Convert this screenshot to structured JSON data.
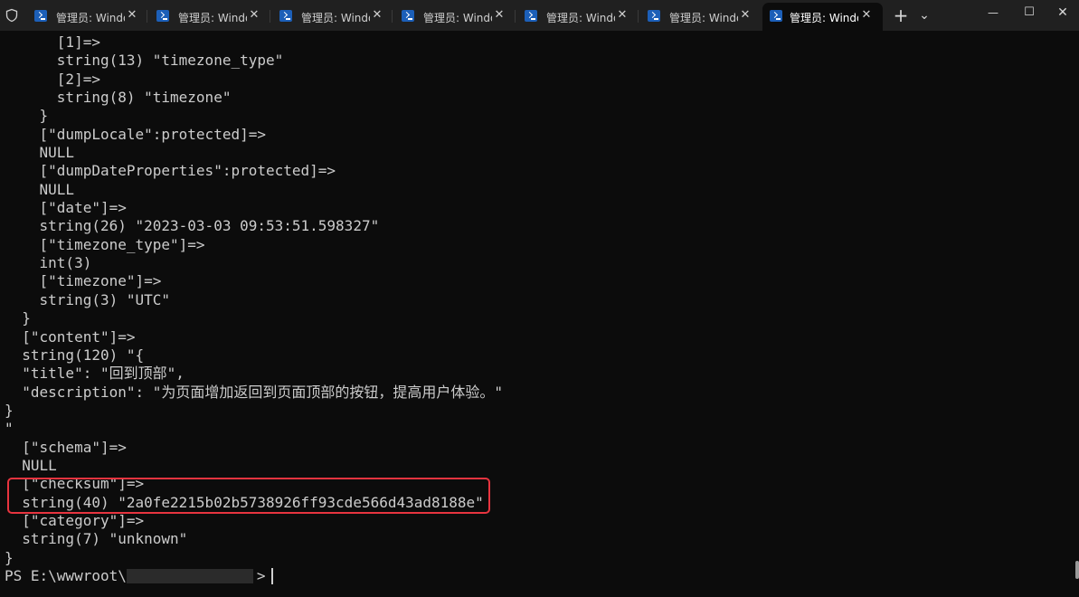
{
  "window": {
    "tabs": [
      {
        "label": "管理员: Windows PowerShell",
        "active": false
      },
      {
        "label": "管理员: Windows PowerShell",
        "active": false
      },
      {
        "label": "管理员: Windows PowerShell",
        "active": false
      },
      {
        "label": "管理员: Windows PowerShell",
        "active": false
      },
      {
        "label": "管理员: Windows PowerShell",
        "active": false
      },
      {
        "label": "管理员: Windows PowerShell",
        "active": false
      },
      {
        "label": "管理员: Windows PowerShell",
        "active": true
      }
    ],
    "tab_close_glyph": "✕",
    "new_tab_glyph": "+",
    "dropdown_glyph": "⌄",
    "controls": {
      "minimize": "—",
      "maximize": "☐",
      "close": "✕"
    },
    "icons": {
      "shield": "shield-icon",
      "tab": "powershell-icon"
    },
    "colors": {
      "titlebar": "#202020",
      "terminal_bg": "#0c0c0c",
      "text": "#cccccc",
      "highlight_box": "#e8343f",
      "tab_icon": "#1c5fb8"
    }
  },
  "terminal": {
    "lines": [
      "      [1]=>",
      "      string(13) \"timezone_type\"",
      "      [2]=>",
      "      string(8) \"timezone\"",
      "    }",
      "    [\"dumpLocale\":protected]=>",
      "    NULL",
      "    [\"dumpDateProperties\":protected]=>",
      "    NULL",
      "    [\"date\"]=>",
      "    string(26) \"2023-03-03 09:53:51.598327\"",
      "    [\"timezone_type\"]=>",
      "    int(3)",
      "    [\"timezone\"]=>",
      "    string(3) \"UTC\"",
      "  }",
      "  [\"content\"]=>",
      "  string(120) \"{",
      "  \"title\": \"回到顶部\",",
      "  \"description\": \"为页面增加返回到页面顶部的按钮，提高用户体验。\"",
      "}",
      "\"",
      "  [\"schema\"]=>",
      "  NULL",
      "  [\"checksum\"]=>",
      "  string(40) \"2a0fe2215b02b5738926ff93cde566d43ad8188e\"",
      "  [\"category\"]=>",
      "  string(7) \"unknown\"",
      "}"
    ],
    "prompt": {
      "prefix": "PS E:\\wwwroot\\",
      "suffix": ">"
    }
  }
}
